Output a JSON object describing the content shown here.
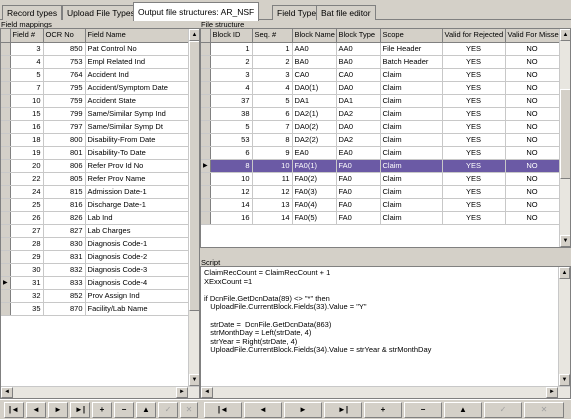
{
  "tabs": [
    {
      "label": "Record types",
      "active": false
    },
    {
      "label": "Upload File Types",
      "active": false
    },
    {
      "label": "Output file structures: AR_NSF",
      "active": true
    },
    {
      "label": "Field Types",
      "active": false
    },
    {
      "label": "Bat file editor",
      "active": false
    }
  ],
  "field_mappings": {
    "label": "Field mappings",
    "columns": [
      "Field #",
      "OCR No",
      "Field Name"
    ],
    "current_row_index": 18,
    "rows": [
      {
        "field": "3",
        "ocr": "850",
        "name": "Pat Control No"
      },
      {
        "field": "4",
        "ocr": "753",
        "name": "Empl Related Ind"
      },
      {
        "field": "5",
        "ocr": "764",
        "name": "Accident Ind"
      },
      {
        "field": "7",
        "ocr": "795",
        "name": "Accident/Symptom Date"
      },
      {
        "field": "10",
        "ocr": "759",
        "name": "Accident State"
      },
      {
        "field": "15",
        "ocr": "799",
        "name": "Same/Similar Symp Ind"
      },
      {
        "field": "16",
        "ocr": "797",
        "name": "Same/Similar Symp Dt"
      },
      {
        "field": "18",
        "ocr": "800",
        "name": "Disability-From Date"
      },
      {
        "field": "19",
        "ocr": "801",
        "name": "Disability-To Date"
      },
      {
        "field": "20",
        "ocr": "806",
        "name": "Refer Prov Id No"
      },
      {
        "field": "22",
        "ocr": "805",
        "name": "Refer Prov Name"
      },
      {
        "field": "24",
        "ocr": "815",
        "name": "Admission Date-1"
      },
      {
        "field": "25",
        "ocr": "816",
        "name": "Discharge Date-1"
      },
      {
        "field": "26",
        "ocr": "826",
        "name": "Lab Ind"
      },
      {
        "field": "27",
        "ocr": "827",
        "name": "Lab Charges"
      },
      {
        "field": "28",
        "ocr": "830",
        "name": "Diagnosis Code-1"
      },
      {
        "field": "29",
        "ocr": "831",
        "name": "Diagnosis Code-2"
      },
      {
        "field": "30",
        "ocr": "832",
        "name": "Diagnosis Code-3"
      },
      {
        "field": "31",
        "ocr": "833",
        "name": "Diagnosis Code-4"
      },
      {
        "field": "32",
        "ocr": "852",
        "name": "Prov Assign Ind"
      },
      {
        "field": "35",
        "ocr": "870",
        "name": "Facility/Lab Name"
      }
    ]
  },
  "file_structure": {
    "label": "File structure",
    "columns": [
      "Block ID",
      "Seq. #",
      "Block Name",
      "Block Type",
      "Scope",
      "Valid for Rejected",
      "Valid For Missed"
    ],
    "selected_row_index": 9,
    "rows": [
      {
        "block_id": "1",
        "seq": "1",
        "block_name": "AA0",
        "block_type": "AA0",
        "scope": "File Header",
        "valid_rejected": "YES",
        "valid_missed": "NO"
      },
      {
        "block_id": "2",
        "seq": "2",
        "block_name": "BA0",
        "block_type": "BA0",
        "scope": "Batch Header",
        "valid_rejected": "YES",
        "valid_missed": "NO"
      },
      {
        "block_id": "3",
        "seq": "3",
        "block_name": "CA0",
        "block_type": "CA0",
        "scope": "Claim",
        "valid_rejected": "YES",
        "valid_missed": "NO"
      },
      {
        "block_id": "4",
        "seq": "4",
        "block_name": "DA0(1)",
        "block_type": "DA0",
        "scope": "Claim",
        "valid_rejected": "YES",
        "valid_missed": "NO"
      },
      {
        "block_id": "37",
        "seq": "5",
        "block_name": "DA1",
        "block_type": "DA1",
        "scope": "Claim",
        "valid_rejected": "YES",
        "valid_missed": "NO"
      },
      {
        "block_id": "38",
        "seq": "6",
        "block_name": "DA2(1)",
        "block_type": "DA2",
        "scope": "Claim",
        "valid_rejected": "YES",
        "valid_missed": "NO"
      },
      {
        "block_id": "5",
        "seq": "7",
        "block_name": "DA0(2)",
        "block_type": "DA0",
        "scope": "Claim",
        "valid_rejected": "YES",
        "valid_missed": "NO"
      },
      {
        "block_id": "53",
        "seq": "8",
        "block_name": "DA2(2)",
        "block_type": "DA2",
        "scope": "Claim",
        "valid_rejected": "YES",
        "valid_missed": "NO"
      },
      {
        "block_id": "6",
        "seq": "9",
        "block_name": "EA0",
        "block_type": "EA0",
        "scope": "Claim",
        "valid_rejected": "YES",
        "valid_missed": "NO"
      },
      {
        "block_id": "8",
        "seq": "10",
        "block_name": "FA0(1)",
        "block_type": "FA0",
        "scope": "Claim",
        "valid_rejected": "YES",
        "valid_missed": "NO"
      },
      {
        "block_id": "10",
        "seq": "11",
        "block_name": "FA0(2)",
        "block_type": "FA0",
        "scope": "Claim",
        "valid_rejected": "YES",
        "valid_missed": "NO"
      },
      {
        "block_id": "12",
        "seq": "12",
        "block_name": "FA0(3)",
        "block_type": "FA0",
        "scope": "Claim",
        "valid_rejected": "YES",
        "valid_missed": "NO"
      },
      {
        "block_id": "14",
        "seq": "13",
        "block_name": "FA0(4)",
        "block_type": "FA0",
        "scope": "Claim",
        "valid_rejected": "YES",
        "valid_missed": "NO"
      },
      {
        "block_id": "16",
        "seq": "14",
        "block_name": "FA0(5)",
        "block_type": "FA0",
        "scope": "Claim",
        "valid_rejected": "YES",
        "valid_missed": "NO"
      }
    ]
  },
  "script": {
    "label": "Script",
    "lines": [
      "ClaimRecCount = ClaimRecCount + 1",
      "XExxCount =1",
      "",
      "if DcnFile.GetDcnData(89) <> \"*\" then",
      "   UploadFile.CurrentBlock.Fields(33).Value = \"Y\"",
      "",
      "   strDate =  DcnFile.GetDcnData(863)",
      "   strMonthDay = Left(strDate, 4)",
      "   strYear = Right(strDate, 4)",
      "   UploadFile.CurrentBlock.Fields(34).Value = strYear & strMonthDay"
    ]
  },
  "left_nav": {
    "first": "|◄",
    "prev": "◄",
    "next": "►",
    "last": "►|",
    "insert": "+",
    "delete": "−",
    "edit": "▲",
    "post": "✓",
    "cancel": "✕"
  },
  "right_nav": {
    "first": "|◄",
    "prev": "◄",
    "next": "►",
    "last": "►|",
    "insert": "+",
    "delete": "−",
    "edit": "▲",
    "post": "✓",
    "cancel": "✕"
  },
  "colors": {
    "selection": "#6b5aa5",
    "panel": "#d4d0c8"
  }
}
